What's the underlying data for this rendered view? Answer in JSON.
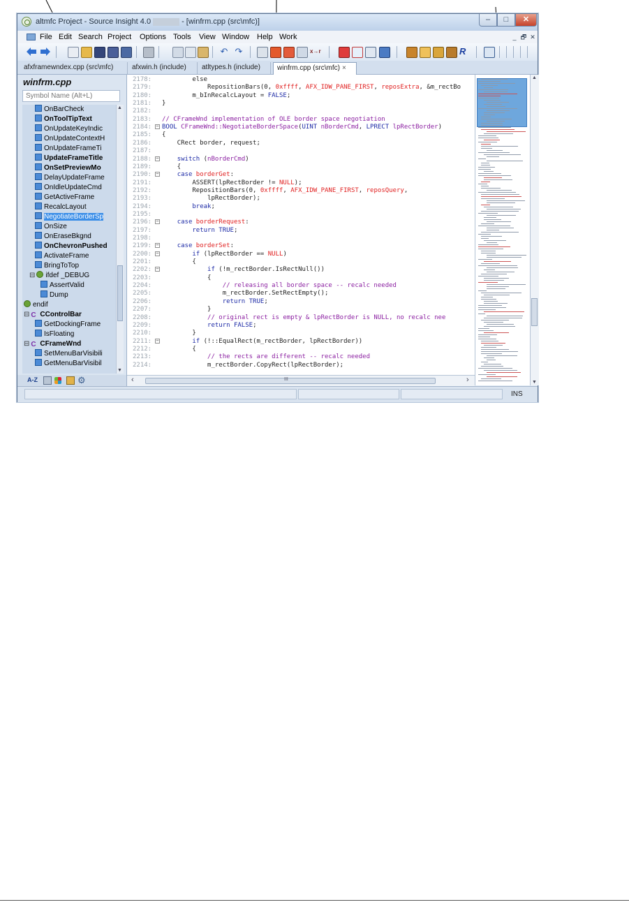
{
  "window": {
    "title_prefix": "altmfc Project - Source Insight 4.0",
    "title_suffix": "- [winfrm.cpp (src\\mfc)]",
    "minimize": "–",
    "maximize": "□",
    "close": "✕"
  },
  "menu": [
    "File",
    "Edit",
    "Search",
    "Project",
    "Options",
    "Tools",
    "View",
    "Window",
    "Help",
    "Work"
  ],
  "mdi_controls": [
    "_",
    "🗗",
    "✕"
  ],
  "tabs": [
    {
      "label": "afxframewndex.cpp (src\\mfc)"
    },
    {
      "label": "afxwin.h (include)"
    },
    {
      "label": "atltypes.h (include)"
    },
    {
      "label": "winfrm.cpp (src\\mfc)",
      "close": "×"
    }
  ],
  "symbol_window": {
    "title": "winfrm.cpp",
    "search_placeholder": "Symbol Name (Alt+L)",
    "items": [
      {
        "label": "OnBarCheck",
        "icon": "method-icon",
        "bold": false,
        "indent": 2
      },
      {
        "label": "OnToolTipText",
        "icon": "method-icon",
        "bold": true,
        "indent": 2
      },
      {
        "label": "OnUpdateKeyIndic",
        "icon": "method-icon",
        "bold": false,
        "indent": 2
      },
      {
        "label": "OnUpdateContextH",
        "icon": "method-icon",
        "bold": false,
        "indent": 2
      },
      {
        "label": "OnUpdateFrameTi",
        "icon": "method-icon",
        "bold": false,
        "indent": 2
      },
      {
        "label": "UpdateFrameTitle",
        "icon": "method-icon",
        "bold": true,
        "indent": 2
      },
      {
        "label": "OnSetPreviewMo",
        "icon": "method-icon",
        "bold": true,
        "indent": 2
      },
      {
        "label": "DelayUpdateFrame",
        "icon": "method-icon",
        "bold": false,
        "indent": 2
      },
      {
        "label": "OnIdleUpdateCmd",
        "icon": "method-icon",
        "bold": false,
        "indent": 2
      },
      {
        "label": "GetActiveFrame",
        "icon": "method-icon",
        "bold": false,
        "indent": 2
      },
      {
        "label": "RecalcLayout",
        "icon": "method-icon",
        "bold": false,
        "indent": 2
      },
      {
        "label": "NegotiateBorderSp",
        "icon": "method-icon",
        "bold": false,
        "indent": 2,
        "selected": true
      },
      {
        "label": "OnSize",
        "icon": "method-icon",
        "bold": false,
        "indent": 2
      },
      {
        "label": "OnEraseBkgnd",
        "icon": "method-icon",
        "bold": false,
        "indent": 2
      },
      {
        "label": "OnChevronPushed",
        "icon": "method-icon",
        "bold": true,
        "indent": 2
      },
      {
        "label": "ActivateFrame",
        "icon": "method-icon",
        "bold": false,
        "indent": 2
      },
      {
        "label": "BringToTop",
        "icon": "method-icon",
        "bold": false,
        "indent": 2
      },
      {
        "label": "ifdef _DEBUG",
        "icon": "preproc-icon",
        "bold": false,
        "indent": 1,
        "toggle": "⊟"
      },
      {
        "label": "AssertValid",
        "icon": "method-icon",
        "bold": false,
        "indent": 3
      },
      {
        "label": "Dump",
        "icon": "method-icon",
        "bold": false,
        "indent": 3
      },
      {
        "label": "endif",
        "icon": "preproc-icon",
        "bold": false,
        "indent": 0
      },
      {
        "label": "CControlBar",
        "icon": "class-icon",
        "bold": true,
        "indent": 0,
        "toggle": "⊟"
      },
      {
        "label": "GetDockingFrame",
        "icon": "method-icon",
        "bold": false,
        "indent": 2
      },
      {
        "label": "IsFloating",
        "icon": "method-icon",
        "bold": false,
        "indent": 2
      },
      {
        "label": "CFrameWnd",
        "icon": "class-icon",
        "bold": true,
        "indent": 0,
        "toggle": "⊟"
      },
      {
        "label": "SetMenuBarVisibili",
        "icon": "method-icon",
        "bold": false,
        "indent": 2
      },
      {
        "label": "GetMenuBarVisibil",
        "icon": "method-icon",
        "bold": false,
        "indent": 2
      }
    ],
    "footer_sort": "A-Z"
  },
  "code": [
    {
      "n": "2178:",
      "parts": [
        [
          "dk",
          "        else"
        ]
      ]
    },
    {
      "n": "2179:",
      "parts": [
        [
          "dk",
          "            RepositionBars(0, "
        ],
        [
          "red",
          "0xffff"
        ],
        [
          "dk",
          ", "
        ],
        [
          "red",
          "AFX_IDW_PANE_FIRST"
        ],
        [
          "dk",
          ", "
        ],
        [
          "red",
          "reposExtra"
        ],
        [
          "dk",
          ", &m_rectBo"
        ]
      ]
    },
    {
      "n": "2180:",
      "parts": [
        [
          "dk",
          "        m_bInRecalcLayout = "
        ],
        [
          "kw",
          "FALSE"
        ],
        [
          "dk",
          ";"
        ]
      ]
    },
    {
      "n": "2181:",
      "parts": [
        [
          "dk",
          "}"
        ]
      ]
    },
    {
      "n": "2182:",
      "parts": []
    },
    {
      "n": "2183:",
      "parts": [
        [
          "cmt",
          "// CFrameWnd implementation of OLE border space negotiation"
        ]
      ]
    },
    {
      "n": "2184:",
      "fold": "−",
      "parts": [
        [
          "kw",
          "BOOL "
        ],
        [
          "pur",
          "CFrameWnd::NegotiateBorderSpace"
        ],
        [
          "dk",
          "("
        ],
        [
          "kw",
          "UINT "
        ],
        [
          "pur",
          "nBorderCmd"
        ],
        [
          "dk",
          ", "
        ],
        [
          "kw",
          "LPRECT "
        ],
        [
          "pur",
          "lpRectBorder"
        ],
        [
          "dk",
          ")"
        ]
      ]
    },
    {
      "n": "2185:",
      "parts": [
        [
          "dk",
          "{"
        ]
      ]
    },
    {
      "n": "2186:",
      "parts": [
        [
          "dk",
          "    CRect border, request;"
        ]
      ]
    },
    {
      "n": "2187:",
      "parts": []
    },
    {
      "n": "2188:",
      "fold": "−",
      "parts": [
        [
          "dk",
          "    "
        ],
        [
          "kw",
          "switch"
        ],
        [
          "dk",
          " ("
        ],
        [
          "pur",
          "nBorderCmd"
        ],
        [
          "dk",
          ")"
        ]
      ]
    },
    {
      "n": "2189:",
      "parts": [
        [
          "dk",
          "    {"
        ]
      ]
    },
    {
      "n": "2190:",
      "fold": "−",
      "parts": [
        [
          "dk",
          "    "
        ],
        [
          "kw",
          "case "
        ],
        [
          "red",
          "borderGet"
        ],
        [
          "dk",
          ":"
        ]
      ]
    },
    {
      "n": "2191:",
      "parts": [
        [
          "dk",
          "        ASSERT(lpRectBorder != "
        ],
        [
          "red",
          "NULL"
        ],
        [
          "dk",
          ");"
        ]
      ]
    },
    {
      "n": "2192:",
      "parts": [
        [
          "dk",
          "        RepositionBars(0, "
        ],
        [
          "red",
          "0xffff"
        ],
        [
          "dk",
          ", "
        ],
        [
          "red",
          "AFX_IDW_PANE_FIRST"
        ],
        [
          "dk",
          ", "
        ],
        [
          "red",
          "reposQuery"
        ],
        [
          "dk",
          ","
        ]
      ]
    },
    {
      "n": "2193:",
      "parts": [
        [
          "dk",
          "            lpRectBorder);"
        ]
      ]
    },
    {
      "n": "2194:",
      "parts": [
        [
          "dk",
          "        "
        ],
        [
          "kw",
          "break"
        ],
        [
          "dk",
          ";"
        ]
      ]
    },
    {
      "n": "2195:",
      "parts": []
    },
    {
      "n": "2196:",
      "fold": "−",
      "parts": [
        [
          "dk",
          "    "
        ],
        [
          "kw",
          "case "
        ],
        [
          "red",
          "borderRequest"
        ],
        [
          "dk",
          ":"
        ]
      ]
    },
    {
      "n": "2197:",
      "parts": [
        [
          "dk",
          "        "
        ],
        [
          "kw",
          "return "
        ],
        [
          "kw",
          "TRUE"
        ],
        [
          "dk",
          ";"
        ]
      ]
    },
    {
      "n": "2198:",
      "parts": []
    },
    {
      "n": "2199:",
      "fold": "−",
      "parts": [
        [
          "dk",
          "    "
        ],
        [
          "kw",
          "case "
        ],
        [
          "red",
          "borderSet"
        ],
        [
          "dk",
          ":"
        ]
      ]
    },
    {
      "n": "2200:",
      "fold": "−",
      "parts": [
        [
          "dk",
          "        "
        ],
        [
          "kw",
          "if"
        ],
        [
          "dk",
          " (lpRectBorder == "
        ],
        [
          "red",
          "NULL"
        ],
        [
          "dk",
          ")"
        ]
      ]
    },
    {
      "n": "2201:",
      "parts": [
        [
          "dk",
          "        {"
        ]
      ]
    },
    {
      "n": "2202:",
      "fold": "−",
      "parts": [
        [
          "dk",
          "            "
        ],
        [
          "kw",
          "if"
        ],
        [
          "dk",
          " (!m_rectBorder.IsRectNull())"
        ]
      ]
    },
    {
      "n": "2203:",
      "parts": [
        [
          "dk",
          "            {"
        ]
      ]
    },
    {
      "n": "2204:",
      "parts": [
        [
          "cmt",
          "                // releasing all border space -- recalc needed"
        ]
      ]
    },
    {
      "n": "2205:",
      "parts": [
        [
          "dk",
          "                m_rectBorder.SetRectEmpty();"
        ]
      ]
    },
    {
      "n": "2206:",
      "parts": [
        [
          "dk",
          "                "
        ],
        [
          "kw",
          "return "
        ],
        [
          "kw",
          "TRUE"
        ],
        [
          "dk",
          ";"
        ]
      ]
    },
    {
      "n": "2207:",
      "parts": [
        [
          "dk",
          "            }"
        ]
      ]
    },
    {
      "n": "2208:",
      "parts": [
        [
          "cmt",
          "            // original rect is empty & lpRectBorder is NULL, no recalc nee"
        ]
      ]
    },
    {
      "n": "2209:",
      "parts": [
        [
          "dk",
          "            "
        ],
        [
          "kw",
          "return "
        ],
        [
          "kw",
          "FALSE"
        ],
        [
          "dk",
          ";"
        ]
      ]
    },
    {
      "n": "2210:",
      "parts": [
        [
          "dk",
          "        }"
        ]
      ]
    },
    {
      "n": "2211:",
      "fold": "−",
      "parts": [
        [
          "dk",
          "        "
        ],
        [
          "kw",
          "if"
        ],
        [
          "dk",
          " (!::EqualRect(m_rectBorder, lpRectBorder))"
        ]
      ]
    },
    {
      "n": "2212:",
      "parts": [
        [
          "dk",
          "        {"
        ]
      ]
    },
    {
      "n": "2213:",
      "parts": [
        [
          "cmt",
          "            // the rects are different -- recalc needed"
        ]
      ]
    },
    {
      "n": "2214:",
      "parts": [
        [
          "dk",
          "            m_rectBorder.CopyRect(lpRectBorder);"
        ]
      ]
    }
  ],
  "scrollbar": {
    "left_arrow": "‹",
    "grip": "III",
    "right_arrow": "›"
  },
  "status": {
    "mode": "INS"
  },
  "colors": {
    "keyword": "#1c2aa6",
    "constant": "#e02020",
    "identifier": "#8b1fa1",
    "selection": "#3b8ee8"
  }
}
